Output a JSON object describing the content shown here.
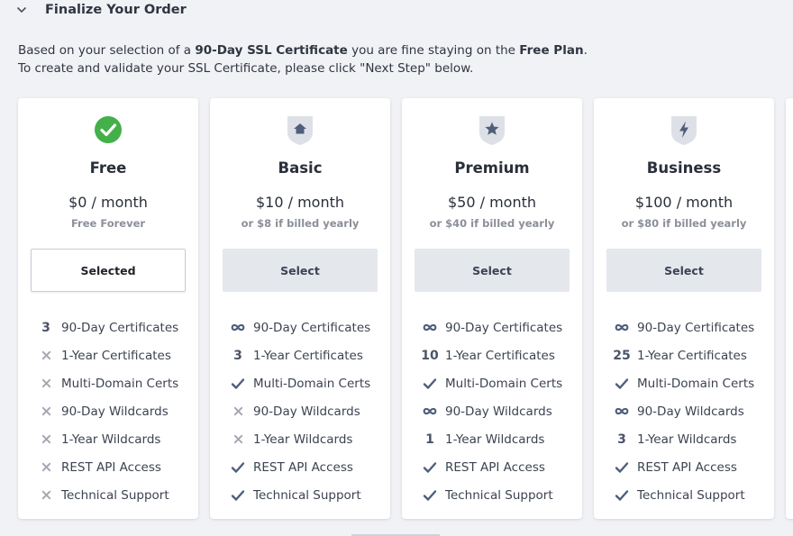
{
  "header": {
    "title": "Finalize Your Order",
    "toggle_icon": "chevron-down-icon"
  },
  "intro": {
    "line1_prefix": "Based on your selection of a ",
    "line1_bold1": "90-Day SSL Certificate",
    "line1_middle": " you are fine staying on the ",
    "line1_bold2": "Free Plan",
    "line1_suffix": ".",
    "line2": "To create and validate your SSL Certificate, please click \"Next Step\" below."
  },
  "colors": {
    "accent_green": "#43b049",
    "icon_blue": "#4f5f79",
    "muted": "#9aa0a8"
  },
  "plans": [
    {
      "name": "Free",
      "price": "$0 / month",
      "sub": "Free Forever",
      "button": "Selected",
      "selected": true,
      "icon": "check-circle-icon",
      "features": [
        {
          "mark": "3",
          "label": "90-Day Certificates"
        },
        {
          "mark": "x",
          "label": "1-Year Certificates"
        },
        {
          "mark": "x",
          "label": "Multi-Domain Certs"
        },
        {
          "mark": "x",
          "label": "90-Day Wildcards"
        },
        {
          "mark": "x",
          "label": "1-Year Wildcards"
        },
        {
          "mark": "x",
          "label": "REST API Access"
        },
        {
          "mark": "x",
          "label": "Technical Support"
        }
      ]
    },
    {
      "name": "Basic",
      "price": "$10 / month",
      "sub": "or $8 if billed yearly",
      "button": "Select",
      "selected": false,
      "icon": "house-shield-icon",
      "features": [
        {
          "mark": "inf",
          "label": "90-Day Certificates"
        },
        {
          "mark": "3",
          "label": "1-Year Certificates"
        },
        {
          "mark": "check",
          "label": "Multi-Domain Certs"
        },
        {
          "mark": "x",
          "label": "90-Day Wildcards"
        },
        {
          "mark": "x",
          "label": "1-Year Wildcards"
        },
        {
          "mark": "check",
          "label": "REST API Access"
        },
        {
          "mark": "check",
          "label": "Technical Support"
        }
      ]
    },
    {
      "name": "Premium",
      "price": "$50 / month",
      "sub": "or $40 if billed yearly",
      "button": "Select",
      "selected": false,
      "icon": "star-shield-icon",
      "features": [
        {
          "mark": "inf",
          "label": "90-Day Certificates"
        },
        {
          "mark": "10",
          "label": "1-Year Certificates"
        },
        {
          "mark": "check",
          "label": "Multi-Domain Certs"
        },
        {
          "mark": "inf",
          "label": "90-Day Wildcards"
        },
        {
          "mark": "1",
          "label": "1-Year Wildcards"
        },
        {
          "mark": "check",
          "label": "REST API Access"
        },
        {
          "mark": "check",
          "label": "Technical Support"
        }
      ]
    },
    {
      "name": "Business",
      "price": "$100 / month",
      "sub": "or $80 if billed yearly",
      "button": "Select",
      "selected": false,
      "icon": "bolt-shield-icon",
      "features": [
        {
          "mark": "inf",
          "label": "90-Day Certificates"
        },
        {
          "mark": "25",
          "label": "1-Year Certificates"
        },
        {
          "mark": "check",
          "label": "Multi-Domain Certs"
        },
        {
          "mark": "inf",
          "label": "90-Day Wildcards"
        },
        {
          "mark": "3",
          "label": "1-Year Wildcards"
        },
        {
          "mark": "check",
          "label": "REST API Access"
        },
        {
          "mark": "check",
          "label": "Technical Support"
        }
      ]
    }
  ]
}
